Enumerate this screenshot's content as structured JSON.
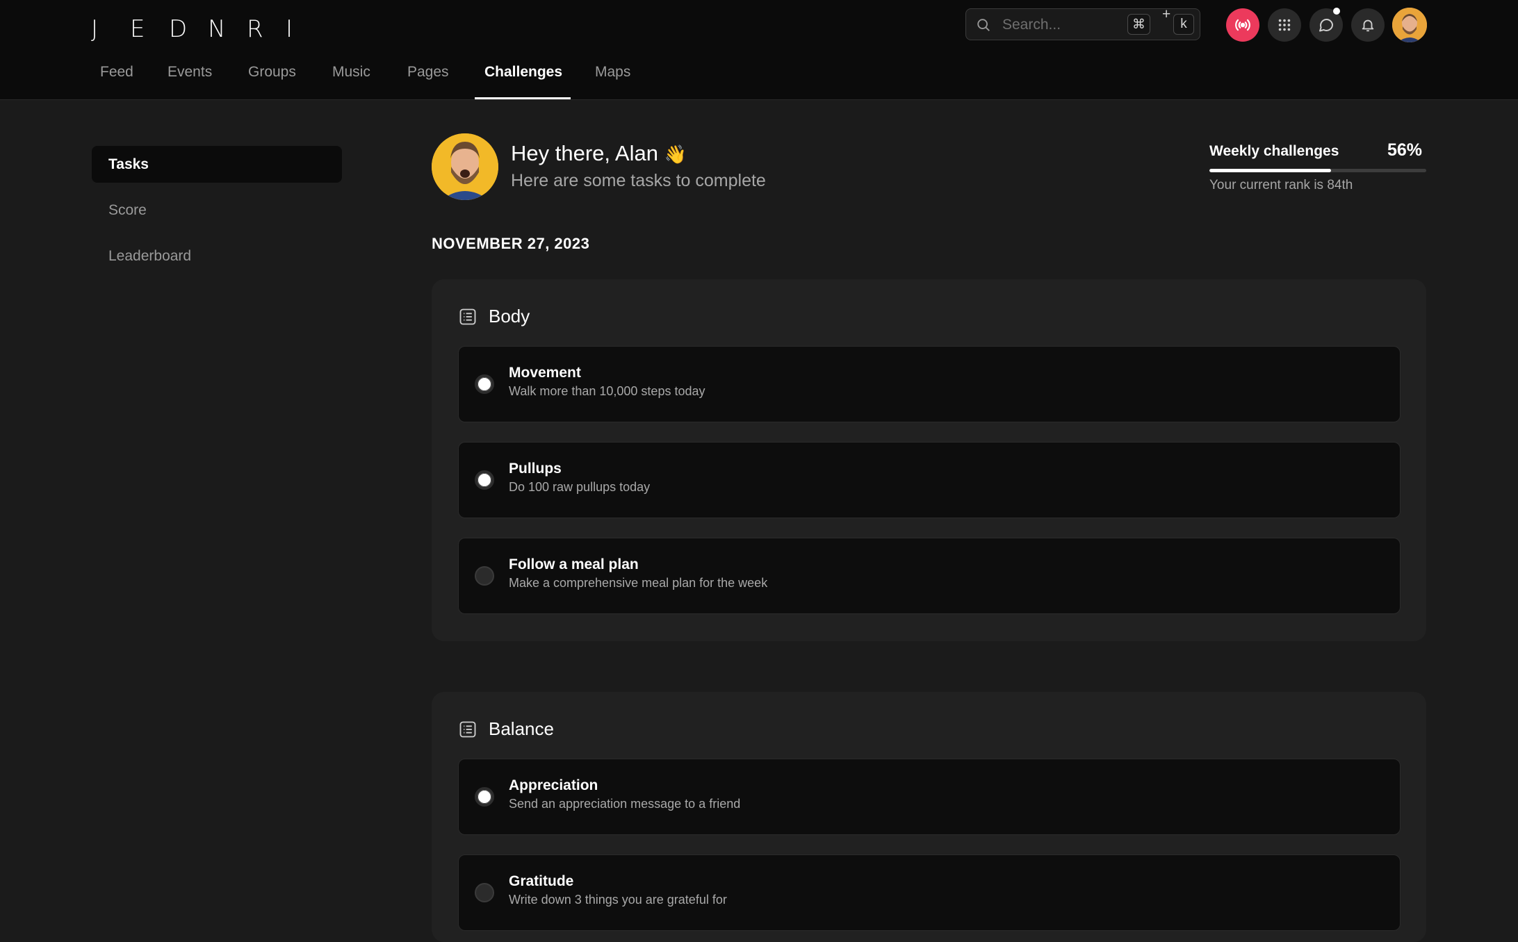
{
  "logo": [
    "J",
    "E",
    "D",
    "N",
    "R",
    "I"
  ],
  "search": {
    "placeholder": "Search...",
    "kbd_cmd": "⌘",
    "kbd_plus": "+",
    "kbd_key": "k"
  },
  "nav": {
    "items": [
      {
        "label": "Feed"
      },
      {
        "label": "Events"
      },
      {
        "label": "Groups"
      },
      {
        "label": "Music"
      },
      {
        "label": "Pages"
      },
      {
        "label": "Challenges",
        "active": true
      },
      {
        "label": "Maps"
      }
    ]
  },
  "header_icons": [
    "live-broadcast-icon",
    "apps-grid-icon",
    "chat-icon",
    "bell-icon"
  ],
  "sidebar": {
    "items": [
      {
        "label": "Tasks",
        "active": true
      },
      {
        "label": "Score"
      },
      {
        "label": "Leaderboard"
      }
    ]
  },
  "main": {
    "greeting": "Hey there, Alan",
    "greeting_emoji": "👋",
    "subtitle": "Here are some tasks to complete",
    "weekly": {
      "title": "Weekly challenges",
      "percent": "56%",
      "progress": 0.56,
      "rank": "Your current rank is 84th"
    },
    "date": "NOVEMBER 27, 2023",
    "sections": [
      {
        "title": "Body",
        "tasks": [
          {
            "title": "Movement",
            "desc": "Walk more than 10,000 steps today",
            "checked": true
          },
          {
            "title": "Pullups",
            "desc": "Do 100 raw pullups today",
            "checked": true
          },
          {
            "title": "Follow a meal plan",
            "desc": "Make a comprehensive meal plan for the week",
            "checked": false
          }
        ]
      },
      {
        "title": "Balance",
        "tasks": [
          {
            "title": "Appreciation",
            "desc": "Send an appreciation message to a friend",
            "checked": true
          },
          {
            "title": "Gratitude",
            "desc": "Write down 3 things you are grateful for",
            "checked": false
          }
        ]
      }
    ]
  },
  "colors": {
    "live": "#ec3a5c",
    "background": "#1b1b1b",
    "header": "#0b0b0b",
    "card": "#212121",
    "task": "#0d0d0d"
  }
}
